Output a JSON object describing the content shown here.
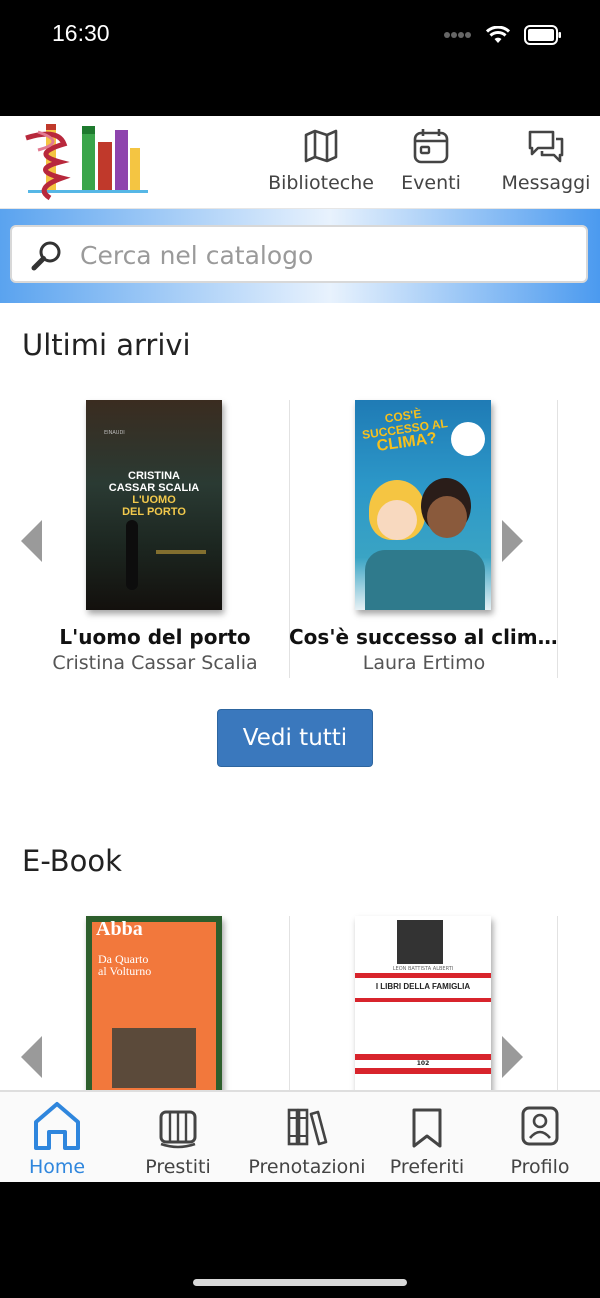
{
  "status": {
    "time": "16:30"
  },
  "header": {
    "nav": [
      {
        "label": "Biblioteche",
        "icon": "map-icon"
      },
      {
        "label": "Eventi",
        "icon": "calendar-icon"
      },
      {
        "label": "Messaggi",
        "icon": "chat-icon"
      }
    ]
  },
  "search": {
    "placeholder": "Cerca nel catalogo"
  },
  "sections": {
    "latest": {
      "title": "Ultimi arrivi",
      "books": [
        {
          "title": "L'uomo del porto",
          "author": "Cristina Cassar Scalia",
          "cover_lines": [
            "CRISTINA",
            "CASSAR SCALIA",
            "L'UOMO",
            "DEL PORTO"
          ],
          "cover_brand": "EINAUDI"
        },
        {
          "title": "Cos'è successo al clim...",
          "author": "Laura Ertimo",
          "cover_lines": [
            "COS'È",
            "SUCCESSO AL",
            "CLIMA?"
          ]
        }
      ],
      "see_all": "Vedi tutti"
    },
    "ebook": {
      "title": "E-Book",
      "books": [
        {
          "cover_lines": [
            "Abba",
            "Da Quarto",
            "al Volturno"
          ]
        },
        {
          "cover_lines": [
            "LEON BATTISTA ALBERTI",
            "I LIBRI DELLA FAMIGLIA",
            "102"
          ]
        }
      ]
    }
  },
  "tabs": [
    {
      "label": "Home",
      "icon": "home-icon",
      "active": true
    },
    {
      "label": "Prestiti",
      "icon": "book-open-icon",
      "active": false
    },
    {
      "label": "Prenotazioni",
      "icon": "books-shelf-icon",
      "active": false
    },
    {
      "label": "Preferiti",
      "icon": "bookmark-icon",
      "active": false
    },
    {
      "label": "Profilo",
      "icon": "profile-icon",
      "active": false
    }
  ],
  "colors": {
    "accent": "#2f86dd",
    "button": "#3a78bd",
    "search_band": "#5aa3ef"
  }
}
